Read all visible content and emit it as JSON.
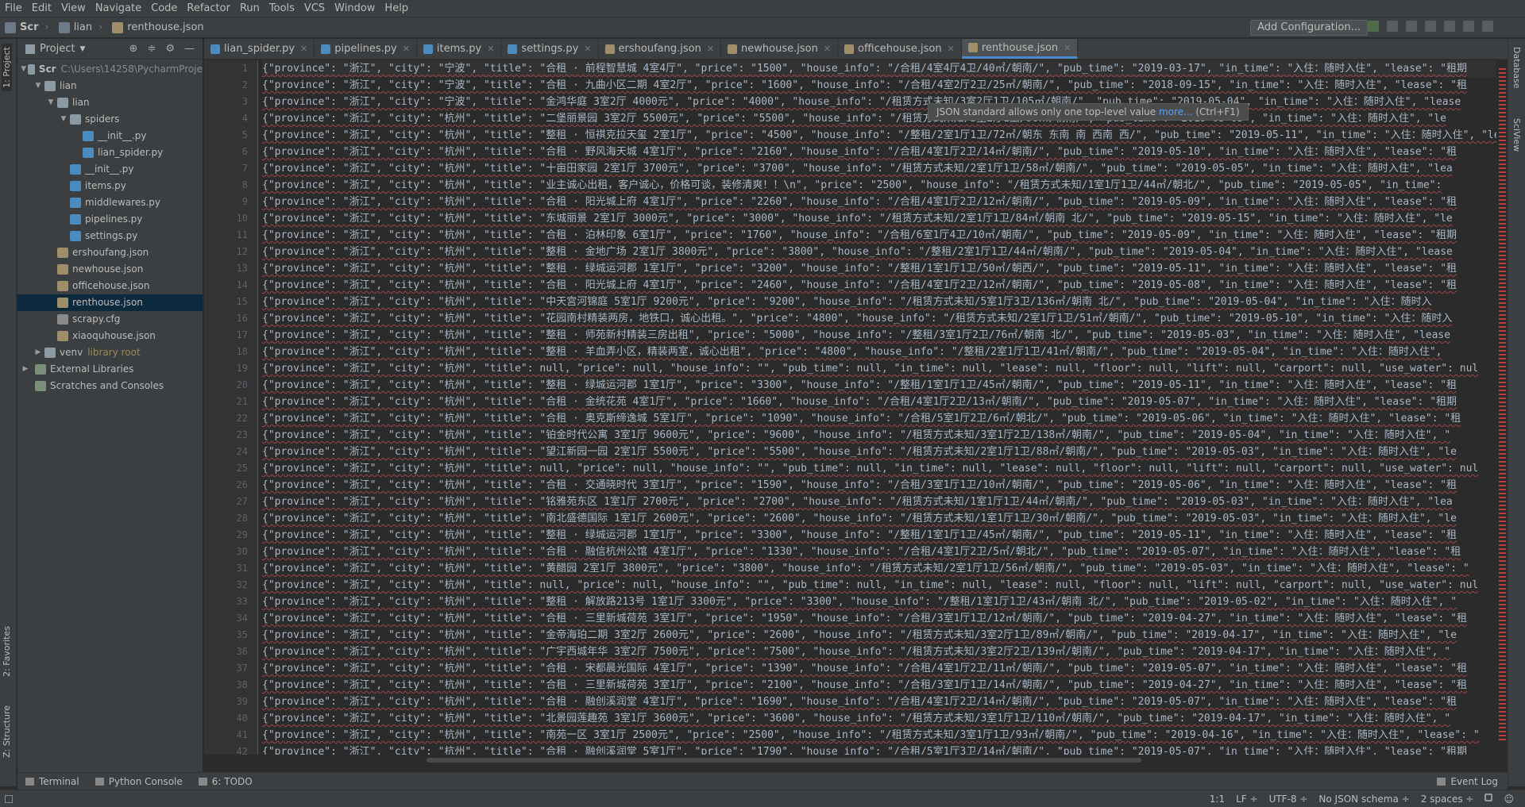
{
  "menu": [
    "File",
    "Edit",
    "View",
    "Navigate",
    "Code",
    "Refactor",
    "Run",
    "Tools",
    "VCS",
    "Window",
    "Help"
  ],
  "breadcrumb": [
    "Scr",
    "lian",
    "renthouse.json"
  ],
  "toolbar": {
    "run_config": "Add Configuration..."
  },
  "left_tools": {
    "project": "1: Project",
    "favorites": "2: Favorites",
    "structure": "Z: Structure"
  },
  "right_tools": {
    "database": "Database",
    "sciview": "SciView"
  },
  "project_panel": {
    "title": "Project",
    "tree": [
      {
        "label": "Scr",
        "extra": "C:\\Users\\14258\\PycharmProje",
        "type": "folder",
        "depth": 0,
        "arrow": "▼"
      },
      {
        "label": "lian",
        "type": "folder",
        "depth": 1,
        "arrow": "▼"
      },
      {
        "label": "lian",
        "type": "folder",
        "depth": 2,
        "arrow": "▼"
      },
      {
        "label": "spiders",
        "type": "folder",
        "depth": 3,
        "arrow": "▼"
      },
      {
        "label": "__init__.py",
        "type": "py",
        "depth": 4,
        "arrow": ""
      },
      {
        "label": "lian_spider.py",
        "type": "py",
        "depth": 4,
        "arrow": ""
      },
      {
        "label": "__init__.py",
        "type": "py",
        "depth": 3,
        "arrow": ""
      },
      {
        "label": "items.py",
        "type": "py",
        "depth": 3,
        "arrow": ""
      },
      {
        "label": "middlewares.py",
        "type": "py",
        "depth": 3,
        "arrow": ""
      },
      {
        "label": "pipelines.py",
        "type": "py",
        "depth": 3,
        "arrow": ""
      },
      {
        "label": "settings.py",
        "type": "py",
        "depth": 3,
        "arrow": ""
      },
      {
        "label": "ershoufang.json",
        "type": "json",
        "depth": 2,
        "arrow": ""
      },
      {
        "label": "newhouse.json",
        "type": "json",
        "depth": 2,
        "arrow": ""
      },
      {
        "label": "officehouse.json",
        "type": "json",
        "depth": 2,
        "arrow": ""
      },
      {
        "label": "renthouse.json",
        "type": "json",
        "depth": 2,
        "arrow": "",
        "selected": true
      },
      {
        "label": "scrapy.cfg",
        "type": "cfg",
        "depth": 2,
        "arrow": ""
      },
      {
        "label": "xiaoquhouse.json",
        "type": "json",
        "depth": 2,
        "arrow": ""
      },
      {
        "label": "venv",
        "lib": "library root",
        "type": "folder",
        "depth": 1,
        "arrow": "▶"
      },
      {
        "label": "External Libraries",
        "type": "lib",
        "depth": 0,
        "arrow": "▶"
      },
      {
        "label": "Scratches and Consoles",
        "type": "lib",
        "depth": 0,
        "arrow": ""
      }
    ]
  },
  "tabs": [
    {
      "label": "lian_spider.py",
      "type": "py"
    },
    {
      "label": "pipelines.py",
      "type": "py"
    },
    {
      "label": "items.py",
      "type": "py"
    },
    {
      "label": "settings.py",
      "type": "py"
    },
    {
      "label": "ershoufang.json",
      "type": "json"
    },
    {
      "label": "newhouse.json",
      "type": "json"
    },
    {
      "label": "officehouse.json",
      "type": "json"
    },
    {
      "label": "renthouse.json",
      "type": "json",
      "active": true
    }
  ],
  "tooltip": {
    "text": "JSON standard allows only one top-level value ",
    "link": "more...",
    "shortcut": " (Ctrl+F1)"
  },
  "code_lines": [
    "{\"province\": \"浙江\", \"city\": \"宁波\", \"title\": \"合租 · 前程智慧城 4室4厅\", \"price\": \"1500\", \"house_info\": \"/合租/4室4厅4卫/40㎡/朝南/\", \"pub_time\": \"2019-03-17\", \"in_time\": \"入住：随时入住\", \"lease\": \"租期",
    "{\"province\": \"浙江\", \"city\": \"宁波\", \"title\": \"合租 · 九曲小区二期 4室2厅\", \"price\": \"1600\", \"house_info\": \"/合租/4室2厅2卫/25㎡/朝南/\", \"pub_time\": \"2018-09-15\", \"in_time\": \"入住：随时入住\", \"lease\": \"租",
    "{\"province\": \"浙江\", \"city\": \"宁波\", \"title\": \"金鸿华庭 3室2厅 4000元\", \"price\": \"4000\", \"house_info\": \"/租赁方式未知/3室2厅1卫/105㎡/朝南/\", \"pub_time\": \"2019-05-04\", \"in_time\": \"入住：随时入住\", \"lease",
    "{\"province\": \"浙江\", \"city\": \"杭州\", \"title\": \"二堡丽景园 3室2厅 5500元\", \"price\": \"5500\", \"house_info\": \"/租赁方式未知/3室2厅1卫/90㎡/朝南/\", \"pub_time\": \"2019-05-05\", \"in_time\": \"入住：随时入住\", \"le",
    "{\"province\": \"浙江\", \"city\": \"杭州\", \"title\": \"整租 · 恒祺克拉天玺 2室1厅\", \"price\": \"4500\", \"house_info\": \"/整租/2室1厅1卫/72㎡/朝东 东南 南 西南 西/\", \"pub_time\": \"2019-05-11\", \"in_time\": \"入住：随时入住\", \"le",
    "{\"province\": \"浙江\", \"city\": \"杭州\", \"title\": \"合租 · 野风海天城 4室1厅\", \"price\": \"2160\", \"house_info\": \"/合租/4室1厅2卫/14㎡/朝南/\", \"pub_time\": \"2019-05-10\", \"in_time\": \"入住：随时入住\", \"lease\": \"租",
    "{\"province\": \"浙江\", \"city\": \"杭州\", \"title\": \"十亩田家园 2室1厅 3700元\", \"price\": \"3700\", \"house_info\": \"/租赁方式未知/2室1厅1卫/58㎡/朝南/\", \"pub_time\": \"2019-05-05\", \"in_time\": \"入住：随时入住\", \"lea",
    "{\"province\": \"浙江\", \"city\": \"杭州\", \"title\": \"业主诚心出租，客户诚心，价格可谈，装修清爽！！\\n\", \"price\": \"2500\", \"house_info\": \"/租赁方式未知/1室1厅1卫/44㎡/朝北/\", \"pub_time\": \"2019-05-05\", \"in_time\":",
    "{\"province\": \"浙江\", \"city\": \"杭州\", \"title\": \"合租 · 阳光城上府 4室1厅\", \"price\": \"2260\", \"house_info\": \"/合租/4室1厅2卫/12㎡/朝南/\", \"pub_time\": \"2019-05-09\", \"in_time\": \"入住：随时入住\", \"lease\": \"租",
    "{\"province\": \"浙江\", \"city\": \"杭州\", \"title\": \"东城丽景 2室1厅 3000元\", \"price\": \"3000\", \"house_info\": \"/租赁方式未知/2室1厅1卫/84㎡/朝南 北/\", \"pub_time\": \"2019-05-15\", \"in_time\": \"入住：随时入住\", \"le",
    "{\"province\": \"浙江\", \"city\": \"杭州\", \"title\": \"合租 · 泊林印象 6室1厅\", \"price\": \"1760\", \"house_info\": \"/合租/6室1厅4卫/10㎡/朝南/\", \"pub_time\": \"2019-05-09\", \"in_time\": \"入住：随时入住\", \"lease\": \"租期",
    "{\"province\": \"浙江\", \"city\": \"杭州\", \"title\": \"整租 · 金地广场 2室1厅 3800元\", \"price\": \"3800\", \"house_info\": \"/整租/2室1厅1卫/44㎡/朝南/\", \"pub_time\": \"2019-05-04\", \"in_time\": \"入住：随时入住\", \"lease",
    "{\"province\": \"浙江\", \"city\": \"杭州\", \"title\": \"整租 · 绿城运河郡 1室1厅\", \"price\": \"3200\", \"house_info\": \"/整租/1室1厅1卫/50㎡/朝西/\", \"pub_time\": \"2019-05-11\", \"in_time\": \"入住：随时入住\", \"lease\": \"租",
    "{\"province\": \"浙江\", \"city\": \"杭州\", \"title\": \"合租 · 阳光城上府 4室1厅\", \"price\": \"2460\", \"house_info\": \"/合租/4室1厅2卫/12㎡/朝南/\", \"pub_time\": \"2019-05-08\", \"in_time\": \"入住：随时入住\", \"lease\": \"租",
    "{\"province\": \"浙江\", \"city\": \"杭州\", \"title\": \"中天宫河锦庭 5室1厅 9200元\", \"price\": \"9200\", \"house_info\": \"/租赁方式未知/5室1厅3卫/136㎡/朝南 北/\", \"pub_time\": \"2019-05-04\", \"in_time\": \"入住：随时入",
    "{\"province\": \"浙江\", \"city\": \"杭州\", \"title\": \"花园南村精装两房，地铁口，诚心出租。\", \"price\": \"4800\", \"house_info\": \"/租赁方式未知/2室1厅1卫/51㎡/朝南/\", \"pub_time\": \"2019-05-10\", \"in_time\": \"入住：随时入",
    "{\"province\": \"浙江\", \"city\": \"杭州\", \"title\": \"整租 · 师苑新村精装三房出租\", \"price\": \"5000\", \"house_info\": \"/整租/3室1厅2卫/76㎡/朝南 北/\", \"pub_time\": \"2019-05-03\", \"in_time\": \"入住：随时入住\", \"lease",
    "{\"province\": \"浙江\", \"city\": \"杭州\", \"title\": \"整租 · 羊血弄小区，精装两室，诚心出租\", \"price\": \"4800\", \"house_info\": \"/整租/2室1厅1卫/41㎡/朝南/\", \"pub_time\": \"2019-05-04\", \"in_time\": \"入住：随时入住\",",
    "{\"province\": \"浙江\", \"city\": \"杭州\", \"title\": null, \"price\": null, \"house_info\": \"\", \"pub_time\": null, \"in_time\": null, \"lease\": null, \"floor\": null, \"lift\": null, \"carport\": null, \"use_water\": nul",
    "{\"province\": \"浙江\", \"city\": \"杭州\", \"title\": \"整租 · 绿城运河郡 1室1厅\", \"price\": \"3300\", \"house_info\": \"/整租/1室1厅1卫/45㎡/朝南/\", \"pub_time\": \"2019-05-11\", \"in_time\": \"入住：随时入住\", \"lease\": \"租",
    "{\"province\": \"浙江\", \"city\": \"杭州\", \"title\": \"合租 · 金统花苑 4室1厅\", \"price\": \"1660\", \"house_info\": \"/合租/4室1厅2卫/13㎡/朝南/\", \"pub_time\": \"2019-05-07\", \"in_time\": \"入住：随时入住\", \"lease\": \"租期",
    "{\"province\": \"浙江\", \"city\": \"杭州\", \"title\": \"合租 · 奥克斯缔逸城 5室1厅\", \"price\": \"1090\", \"house_info\": \"/合租/5室1厅2卫/6㎡/朝北/\", \"pub_time\": \"2019-05-06\", \"in_time\": \"入住：随时入住\", \"lease\": \"租",
    "{\"province\": \"浙江\", \"city\": \"杭州\", \"title\": \"铂金时代公寓 3室1厅 9600元\", \"price\": \"9600\", \"house_info\": \"/租赁方式未知/3室1厅2卫/138㎡/朝南/\", \"pub_time\": \"2019-05-04\", \"in_time\": \"入住：随时入住\", \"",
    "{\"province\": \"浙江\", \"city\": \"杭州\", \"title\": \"望江新园一园 2室1厅 5500元\", \"price\": \"5500\", \"house_info\": \"/租赁方式未知/2室1厅1卫/88㎡/朝南/\", \"pub_time\": \"2019-05-03\", \"in_time\": \"入住：随时入住\", \"le",
    "{\"province\": \"浙江\", \"city\": \"杭州\", \"title\": null, \"price\": null, \"house_info\": \"\", \"pub_time\": null, \"in_time\": null, \"lease\": null, \"floor\": null, \"lift\": null, \"carport\": null, \"use_water\": nul",
    "{\"province\": \"浙江\", \"city\": \"杭州\", \"title\": \"合租 · 交通晓时代 3室1厅\", \"price\": \"1590\", \"house_info\": \"/合租/3室1厅1卫/10㎡/朝南/\", \"pub_time\": \"2019-05-06\", \"in_time\": \"入住：随时入住\", \"lease\": \"租",
    "{\"province\": \"浙江\", \"city\": \"杭州\", \"title\": \"铭雅苑东区 1室1厅 2700元\", \"price\": \"2700\", \"house_info\": \"/租赁方式未知/1室1厅1卫/44㎡/朝南/\", \"pub_time\": \"2019-05-03\", \"in_time\": \"入住：随时入住\", \"lea",
    "{\"province\": \"浙江\", \"city\": \"杭州\", \"title\": \"南北盛德国际 1室1厅 2600元\", \"price\": \"2600\", \"house_info\": \"/租赁方式未知/1室1厅1卫/30㎡/朝南/\", \"pub_time\": \"2019-05-03\", \"in_time\": \"入住：随时入住\", \"le",
    "{\"province\": \"浙江\", \"city\": \"杭州\", \"title\": \"整租 · 绿城运河郡 1室1厅\", \"price\": \"3300\", \"house_info\": \"/整租/1室1厅1卫/45㎡/朝南/\", \"pub_time\": \"2019-05-11\", \"in_time\": \"入住：随时入住\", \"lease\": \"租",
    "{\"province\": \"浙江\", \"city\": \"杭州\", \"title\": \"合租 · 融信杭州公馆 4室1厅\", \"price\": \"1330\", \"house_info\": \"/合租/4室1厅2卫/5㎡/朝北/\", \"pub_time\": \"2019-05-07\", \"in_time\": \"入住：随时入住\", \"lease\": \"租",
    "{\"province\": \"浙江\", \"city\": \"杭州\", \"title\": \"黄醋园 2室1厅 3800元\", \"price\": \"3800\", \"house_info\": \"/租赁方式未知/2室1厅1卫/56㎡/朝南/\", \"pub_time\": \"2019-05-03\", \"in_time\": \"入住：随时入住\", \"lease\": \"",
    "{\"province\": \"浙江\", \"city\": \"杭州\", \"title\": null, \"price\": null, \"house_info\": \"\", \"pub_time\": null, \"in_time\": null, \"lease\": null, \"floor\": null, \"lift\": null, \"carport\": null, \"use_water\": nul",
    "{\"province\": \"浙江\", \"city\": \"杭州\", \"title\": \"整租 · 解放路213号 1室1厅 3300元\", \"price\": \"3300\", \"house_info\": \"/整租/1室1厅1卫/43㎡/朝南 北/\", \"pub_time\": \"2019-05-02\", \"in_time\": \"入住：随时入住\", \"",
    "{\"province\": \"浙江\", \"city\": \"杭州\", \"title\": \"合租 · 三里新城荷苑 3室1厅\", \"price\": \"1950\", \"house_info\": \"/合租/3室1厅1卫/12㎡/朝南/\", \"pub_time\": \"2019-04-27\", \"in_time\": \"入住：随时入住\", \"lease\": \"租",
    "{\"province\": \"浙江\", \"city\": \"杭州\", \"title\": \"金帝海珀二期 3室2厅 2600元\", \"price\": \"2600\", \"house_info\": \"/租赁方式未知/3室2厅1卫/89㎡/朝南/\", \"pub_time\": \"2019-04-17\", \"in_time\": \"入住：随时入住\", \"le",
    "{\"province\": \"浙江\", \"city\": \"杭州\", \"title\": \"广宇西城年华 3室2厅 7500元\", \"price\": \"7500\", \"house_info\": \"/租赁方式未知/3室2厅2卫/139㎡/朝南/\", \"pub_time\": \"2019-04-17\", \"in_time\": \"入住：随时入住\", \"",
    "{\"province\": \"浙江\", \"city\": \"杭州\", \"title\": \"合租 · 宋都晨光国际 4室1厅\", \"price\": \"1390\", \"house_info\": \"/合租/4室1厅2卫/11㎡/朝南/\", \"pub_time\": \"2019-05-07\", \"in_time\": \"入住：随时入住\", \"lease\": \"租",
    "{\"province\": \"浙江\", \"city\": \"杭州\", \"title\": \"合租 · 三里新城荷苑 3室1厅\", \"price\": \"2100\", \"house_info\": \"/合租/3室1厅1卫/14㎡/朝南/\", \"pub_time\": \"2019-04-27\", \"in_time\": \"入住：随时入住\", \"lease\": \"租",
    "{\"province\": \"浙江\", \"city\": \"杭州\", \"title\": \"合租 · 融创溪润堂 4室1厅\", \"price\": \"1690\", \"house_info\": \"/合租/4室1厅2卫/14㎡/朝南/\", \"pub_time\": \"2019-05-07\", \"in_time\": \"入住：随时入住\", \"lease\": \"租",
    "{\"province\": \"浙江\", \"city\": \"杭州\", \"title\": \"北景园莲趣苑 3室1厅 3600元\", \"price\": \"3600\", \"house_info\": \"/租赁方式未知/3室1厅1卫/110㎡/朝南/\", \"pub_time\": \"2019-04-17\", \"in_time\": \"入住：随时入住\", \"",
    "{\"province\": \"浙江\", \"city\": \"杭州\", \"title\": \"南苑一区 3室1厅 2500元\", \"price\": \"2500\", \"house_info\": \"/租赁方式未知/3室1厅1卫/93㎡/朝南/\", \"pub_time\": \"2019-04-16\", \"in_time\": \"入住：随时入住\", \"lease\": \"",
    "{\"province\": \"浙江\", \"city\": \"杭州\", \"title\": \"合租 · 融创溪润堂 5室1厅\", \"price\": \"1790\", \"house_info\": \"/合租/5室1厅3卫/14㎡/朝南/\", \"pub_time\": \"2019-05-07\", \"in_time\": \"入住：随时入住\", \"lease\": \"租期"
  ],
  "bottom_tools": [
    {
      "label": "Terminal",
      "name": "terminal"
    },
    {
      "label": "Python Console",
      "name": "python-console"
    },
    {
      "label": "6: TODO",
      "name": "todo"
    }
  ],
  "event_log": "Event Log",
  "status": {
    "position": "1:1",
    "line_sep": "LF ÷",
    "encoding": "UTF-8 ÷",
    "schema": "No JSON schema ÷",
    "indent": "2 spaces ÷"
  }
}
